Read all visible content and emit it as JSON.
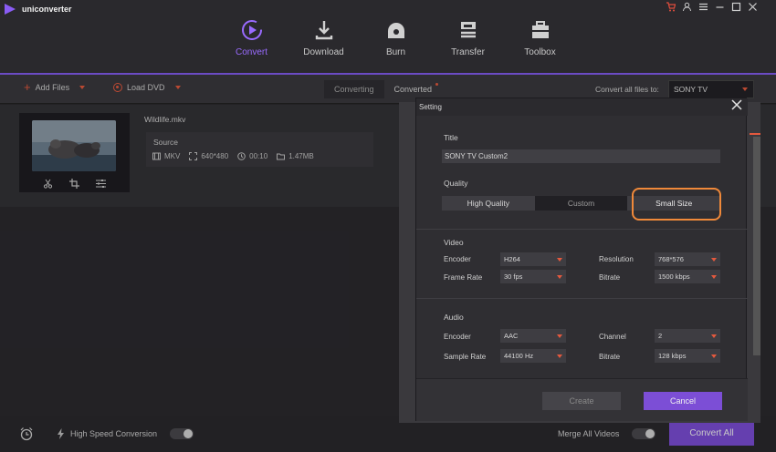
{
  "app": {
    "title": "uniconverter"
  },
  "window_controls": {
    "cart_icon": "cart-icon",
    "user_icon": "user-icon",
    "menu_icon": "menu-icon",
    "min_icon": "minimize-icon",
    "max_icon": "maximize-icon",
    "close_icon": "close-icon"
  },
  "nav": {
    "items": [
      {
        "label": "Convert",
        "icon": "convert-icon",
        "active": true
      },
      {
        "label": "Download",
        "icon": "download-icon"
      },
      {
        "label": "Burn",
        "icon": "burn-icon"
      },
      {
        "label": "Transfer",
        "icon": "transfer-icon"
      },
      {
        "label": "Toolbox",
        "icon": "toolbox-icon"
      }
    ]
  },
  "toolbar": {
    "add_files": "Add Files",
    "load_dvd": "Load DVD",
    "tabs": [
      "Converting",
      "Converted"
    ],
    "convert_all_to_label": "Convert all files to:",
    "target_format": "SONY TV"
  },
  "file": {
    "name": "Wildlife.mkv",
    "source_label": "Source",
    "format": "MKV",
    "resolution": "640*480",
    "duration": "00:10",
    "size": "1.47MB"
  },
  "bottom": {
    "high_speed_label": "High Speed Conversion",
    "merge_label": "Merge All Videos",
    "convert_all_button": "Convert All"
  },
  "dialog": {
    "header": "Setting",
    "title_label": "Title",
    "title_value": "SONY TV Custom2",
    "quality_label": "Quality",
    "quality_options": [
      "High Quality",
      "Custom",
      "Small Size"
    ],
    "quality_selected": "Small Size",
    "video_label": "Video",
    "video": {
      "encoder_label": "Encoder",
      "encoder_value": "H264",
      "resolution_label": "Resolution",
      "resolution_value": "768*576",
      "frame_rate_label": "Frame Rate",
      "frame_rate_value": "30 fps",
      "bitrate_label": "Bitrate",
      "bitrate_value": "1500 kbps"
    },
    "audio_label": "Audio",
    "audio": {
      "encoder_label": "Encoder",
      "encoder_value": "AAC",
      "channel_label": "Channel",
      "channel_value": "2",
      "sample_rate_label": "Sample Rate",
      "sample_rate_value": "44100 Hz",
      "bitrate_label": "Bitrate",
      "bitrate_value": "128 kbps"
    },
    "create_button": "Create",
    "cancel_button": "Cancel"
  },
  "colors": {
    "accent": "#7c4ed6",
    "nav_active": "#9a6bff",
    "warning": "#e3593e",
    "highlight": "#f0893a"
  }
}
